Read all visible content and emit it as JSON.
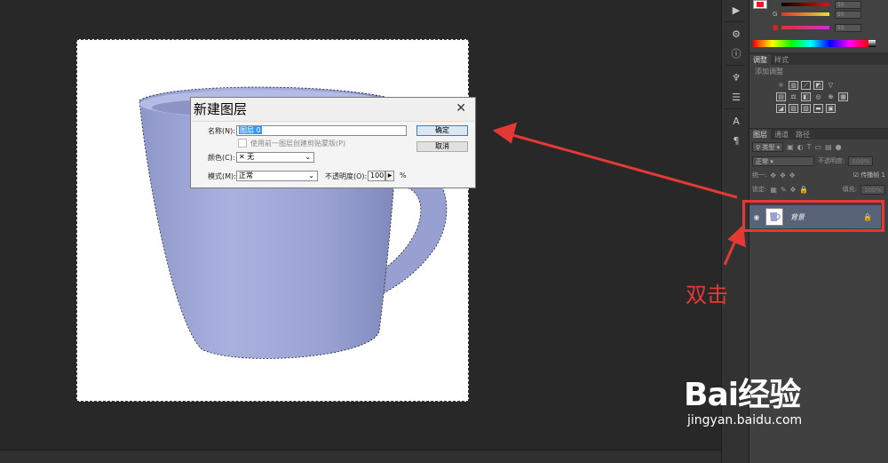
{
  "dialog": {
    "title": "新建图层",
    "name_label": "名称(N):",
    "name_value": "图层 0",
    "clip_label": "使用前一图层创建剪贴蒙版(P)",
    "color_label": "颜色(C):",
    "color_value": "无",
    "mode_label": "模式(M):",
    "mode_value": "正常",
    "opacity_label": "不透明度(O):",
    "opacity_value": "100",
    "opacity_unit": "%",
    "ok_button": "确定",
    "cancel_button": "取消"
  },
  "color_panel": {
    "g_label": "G",
    "r_value": "55",
    "g_value": "55",
    "b_value": "55",
    "accent": "#e02020"
  },
  "adjust_panel": {
    "tabs": [
      "调整",
      "样式"
    ],
    "subtitle": "添加调整"
  },
  "layers_panel": {
    "tabs": [
      "图层",
      "通道",
      "路径"
    ],
    "filter_label": "类型",
    "blend_mode": "正常",
    "opacity_label": "不透明度:",
    "opacity_value": "100%",
    "unify_label": "统一:",
    "propagate_label": "传播帧 1",
    "lock_label": "锁定:",
    "fill_label": "填充:",
    "fill_value": "100%",
    "layer_name": "背景"
  },
  "annotation": {
    "text": "双击",
    "color": "#e53935"
  },
  "watermark": {
    "logo": "Bai经验",
    "url": "jingyan.baidu.com"
  }
}
